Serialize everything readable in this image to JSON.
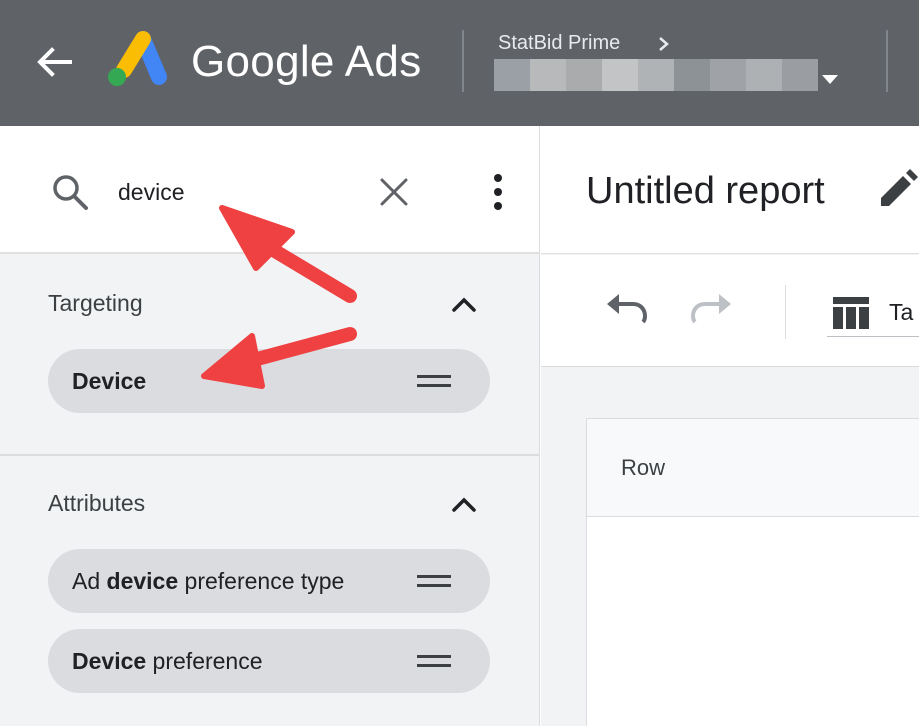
{
  "app": {
    "product_name": "Google Ads",
    "account_name": "StatBid Prime",
    "account_id_blur_colors": [
      "#9aa0a6",
      "#b7b9bb",
      "#a9abad",
      "#c2c4c6",
      "#b0b3b6",
      "#8d9296",
      "#9fa3a7",
      "#aeb1b4",
      "#9a9ea2"
    ],
    "brand_colors": {
      "blue": "#4285f4",
      "yellow": "#fbbc04",
      "green": "#34a853"
    }
  },
  "icons": {
    "back": "arrow-left-icon",
    "logo": "google-ads-logo",
    "account_chevron": "chevron-right-icon",
    "account_caret": "caret-down-icon",
    "search": "search-icon",
    "clear": "close-icon",
    "more": "more-vert-icon",
    "collapse": "chevron-up-icon",
    "drag": "drag-handle-icon",
    "edit": "pencil-icon",
    "undo": "undo-icon",
    "redo": "redo-icon",
    "table": "table-icon"
  },
  "search": {
    "value": "device"
  },
  "sections": {
    "targeting": {
      "title": "Targeting",
      "chips": [
        {
          "bold": "Device",
          "rest": ""
        }
      ]
    },
    "attributes": {
      "title": "Attributes",
      "chips": [
        {
          "pre": "Ad ",
          "bold": "device",
          "rest": " preference type"
        },
        {
          "pre": "",
          "bold": "Device",
          "rest": " preference"
        }
      ]
    }
  },
  "report": {
    "title": "Untitled report",
    "view_label": "Ta",
    "grid_header": "Row"
  },
  "annotation_color": "#ef4141"
}
